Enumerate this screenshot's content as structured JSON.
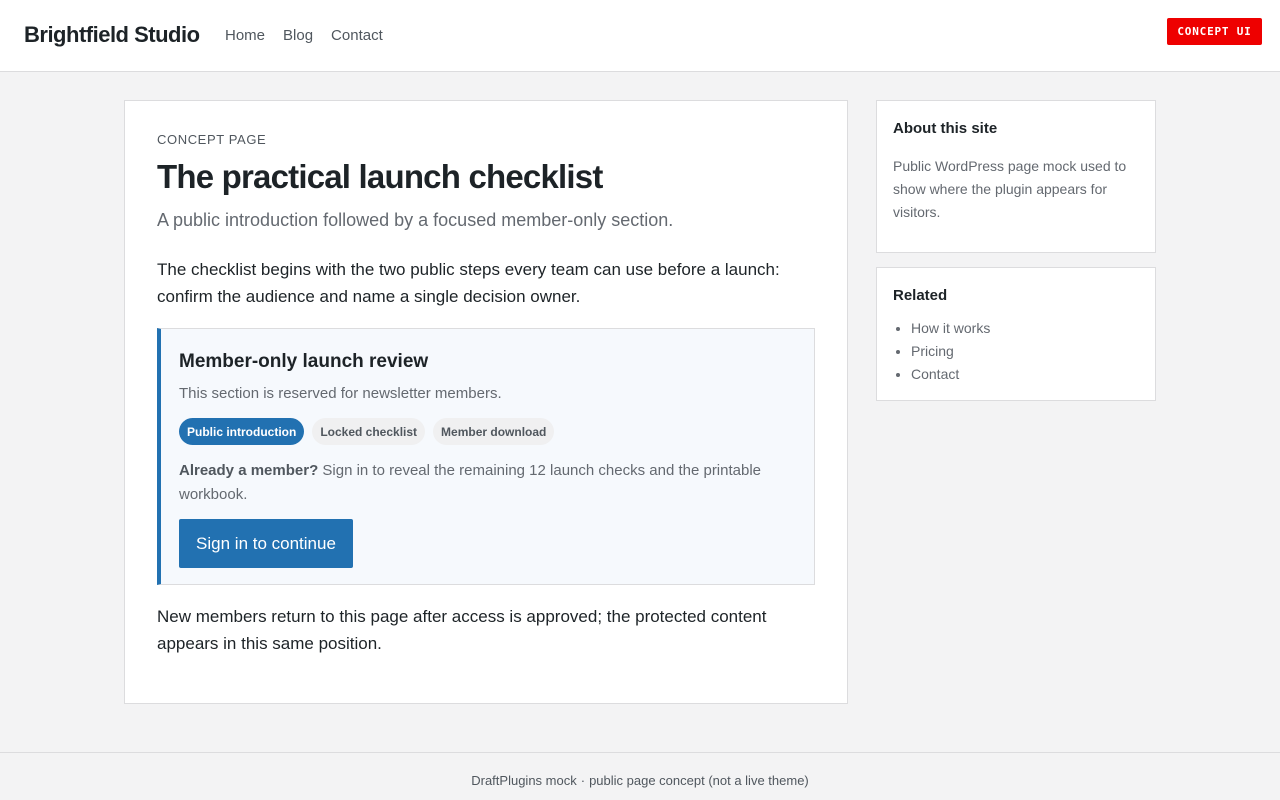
{
  "header": {
    "brand": "Brightfield Studio",
    "nav": [
      "Home",
      "Blog",
      "Contact"
    ],
    "badge": "CONCEPT UI"
  },
  "main": {
    "eyebrow": "CONCEPT PAGE",
    "title": "The practical launch checklist",
    "subtitle": "A public introduction followed by a focused member-only section.",
    "intro": "The checklist begins with the two public steps every team can use before a launch: confirm the audience and name a single decision owner.",
    "member_box": {
      "title": "Member-only launch review",
      "description": "This section is reserved for newsletter members.",
      "pills": [
        "Public introduction",
        "Locked checklist",
        "Member download"
      ],
      "active_pill": "Public introduction",
      "note_lead": "Already a member?",
      "note_text": " Sign in to reveal the remaining 12 launch checks and the printable workbook.",
      "button_label": "Sign in to continue"
    },
    "outro": "New members return to this page after access is approved; the protected content appears in this same position."
  },
  "sidebar": {
    "about": {
      "title": "About this site",
      "text": "Public WordPress page mock used to show where the plugin appears for visitors."
    },
    "related": {
      "title": "Related",
      "items": [
        "How it works",
        "Pricing",
        "Contact"
      ]
    }
  },
  "footer": {
    "left": "DraftPlugins mock",
    "separator": "·",
    "right": "public page concept (not a live theme)"
  },
  "colors": {
    "accent": "#2271b1",
    "badge": "#ee0000",
    "background": "#f3f3f4"
  }
}
